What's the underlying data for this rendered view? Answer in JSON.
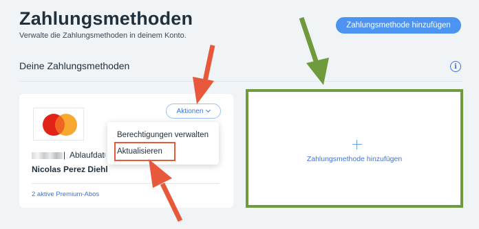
{
  "header": {
    "title": "Zahlungsmethoden",
    "subtitle": "Verwalte die Zahlungsmethoden in deinem Konto.",
    "add_button_label": "Zahlungsmethode hinzufügen"
  },
  "section": {
    "title": "Deine Zahlungsmethoden",
    "info_icon": "i"
  },
  "card": {
    "brand_icon": "mastercard-logo",
    "actions_label": "Aktionen",
    "separator": "|",
    "expiry_label": "Ablaufdatum",
    "holder_name": "Nicolas Perez Diehl",
    "subscriptions_link": "2 aktive Premium-Abos"
  },
  "dropdown": {
    "items": [
      "Berechtigungen verwalten",
      "Aktualisieren"
    ]
  },
  "add_tile": {
    "label": "Zahlungsmethode hinzufügen"
  },
  "colors": {
    "accent": "#4c94f0",
    "annotation_red": "#e8583a",
    "annotation_green": "#6f9b3c"
  }
}
